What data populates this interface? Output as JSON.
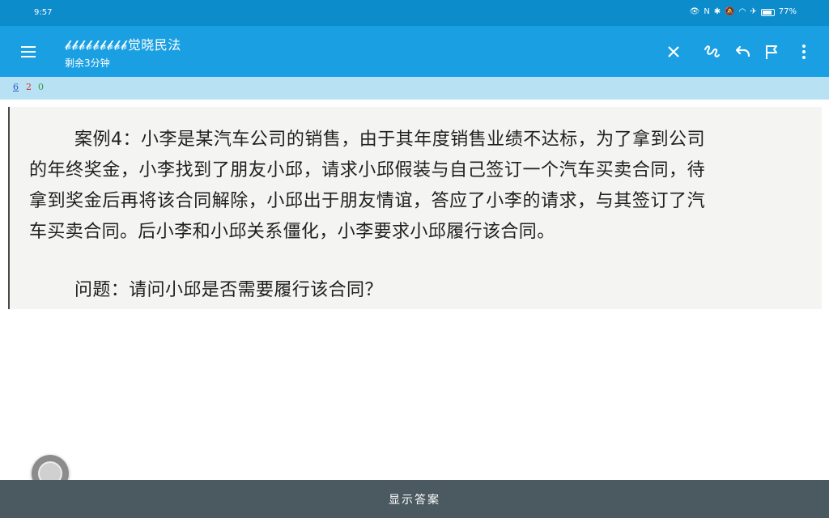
{
  "status_bar": {
    "time": "9:57",
    "battery_text": "77%",
    "icons": [
      "eye-icon",
      "nfc-icon",
      "bluetooth-icon",
      "mute-icon",
      "wifi-icon",
      "airplane-icon",
      "battery-icon"
    ]
  },
  "app_bar": {
    "title": "𝓫𝓫𝓫𝓫𝓫𝓫𝓫𝓫𝓫觉晓民法",
    "subtitle": "剩余3分钟",
    "actions": [
      "close-icon",
      "handwriting-icon",
      "undo-icon",
      "flag-icon",
      "more-vert-icon"
    ]
  },
  "counters": {
    "correct": "6",
    "wrong": "2",
    "other": "0"
  },
  "question": {
    "paragraph": "案例4：小李是某汽车公司的销售，由于其年度销售业绩不达标，为了拿到公司的年终奖金，小李找到了朋友小邱，请求小邱假装与自己签订一个汽车买卖合同，待拿到奖金后再将该合同解除，小邱出于朋友情谊，答应了小李的请求，与其签订了汽车买卖合同。后小李和小邱关系僵化，小李要求小邱履行该合同。",
    "prompt": "问题：请问小邱是否需要履行该合同？"
  },
  "bottom_bar": {
    "label": "显示答案"
  },
  "colors": {
    "status_bar": "#0c8ccb",
    "app_bar": "#1aa0e2",
    "counter_strip": "#b8e2f4",
    "bottom_bar": "#4b5a60"
  }
}
